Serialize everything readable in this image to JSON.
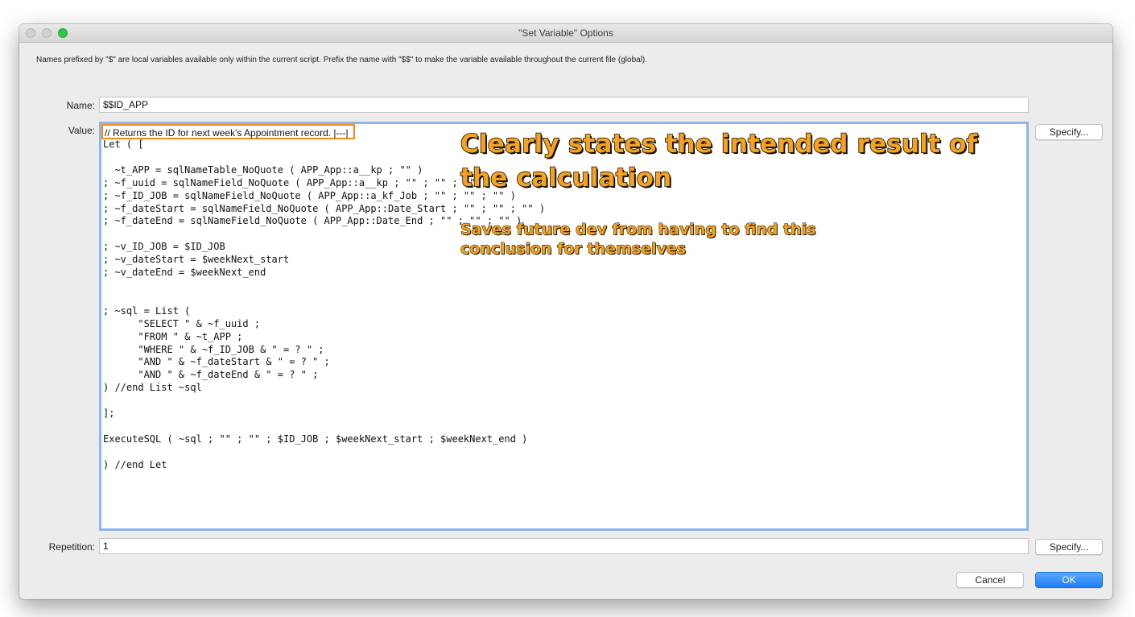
{
  "window": {
    "title": "\"Set Variable\" Options"
  },
  "hint": "Names prefixed by \"$\" are local variables available only within the current script. Prefix the name with \"$$\" to make the variable available throughout the current file (global).",
  "name_label": "Name:",
  "name_value": "$$ID_APP",
  "value_label": "Value:",
  "value_first_line": "// Returns the ID for next week's Appointment record. |---|",
  "value_code": "Let ( [\n\n  ~t_APP = sqlNameTable_NoQuote ( APP_App::a__kp ; \"\" )\n; ~f_uuid = sqlNameField_NoQuote ( APP_App::a__kp ; \"\" ; \"\" ; \"\" )\n; ~f_ID_JOB = sqlNameField_NoQuote ( APP_App::a_kf_Job ; \"\" ; \"\" ; \"\" )\n; ~f_dateStart = sqlNameField_NoQuote ( APP_App::Date_Start ; \"\" ; \"\" ; \"\" )\n; ~f_dateEnd = sqlNameField_NoQuote ( APP_App::Date_End ; \"\" ; \"\" ; \"\" )\n\n; ~v_ID_JOB = $ID_JOB\n; ~v_dateStart = $weekNext_start\n; ~v_dateEnd = $weekNext_end\n\n\n; ~sql = List (\n      \"SELECT \" & ~f_uuid ;\n      \"FROM \" & ~t_APP ;\n      \"WHERE \" & ~f_ID_JOB & \" = ? \" ;\n      \"AND \" & ~f_dateStart & \" = ? \" ;\n      \"AND \" & ~f_dateEnd & \" = ? \" ;\n) //end List ~sql\n\n];\n\nExecuteSQL ( ~sql ; \"\" ; \"\" ; $ID_JOB ; $weekNext_start ; $weekNext_end )\n\n) //end Let",
  "specify_value_label": "Specify...",
  "repetition_label": "Repetition:",
  "repetition_value": "1",
  "specify_repetition_label": "Specify...",
  "cancel_label": "Cancel",
  "ok_label": "OK",
  "annotation": {
    "title": "Clearly states the intended result of the calculation",
    "subtitle": "Saves future dev from having to find this conclusion for themselves"
  },
  "colors": {
    "highlight_box": "#f08c1e",
    "annotation_fill": "#f4a21f",
    "ok_button": "#1e7ef5",
    "focus_ring": "#8fb6e8"
  }
}
